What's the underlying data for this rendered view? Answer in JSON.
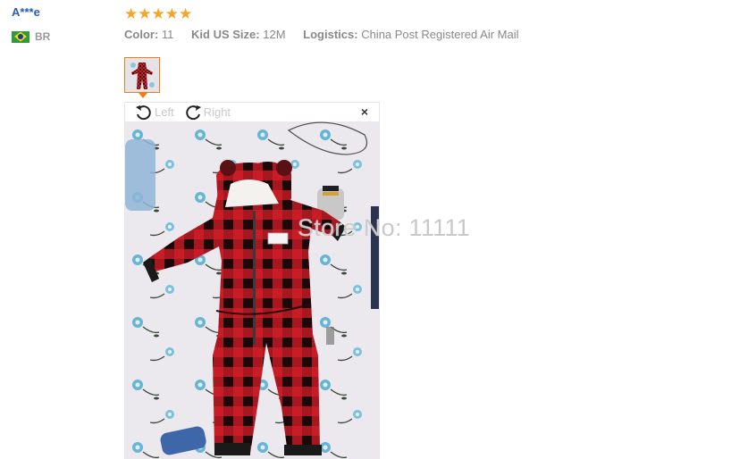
{
  "review": {
    "user_name": "A***e",
    "country_code": "BR",
    "rating": 5,
    "stars": "★★★★★",
    "attributes": [
      {
        "key": "Color:",
        "value": "11"
      },
      {
        "key": "Kid US Size:",
        "value": "12M"
      },
      {
        "key": "Logistics:",
        "value": "China Post Registered Air Mail"
      }
    ]
  },
  "viewer": {
    "rotate_left_label": "Left",
    "rotate_right_label": "Right",
    "close_symbol": "×"
  },
  "watermark": "Store No: 11111",
  "icons": {
    "flag": "brazil-flag-icon",
    "rotate_left": "rotate-left-icon",
    "rotate_right": "rotate-right-icon",
    "close": "close-icon"
  },
  "colors": {
    "username": "#2a5db0",
    "star": "#f5a623",
    "thumb_border": "#f07b1a"
  }
}
